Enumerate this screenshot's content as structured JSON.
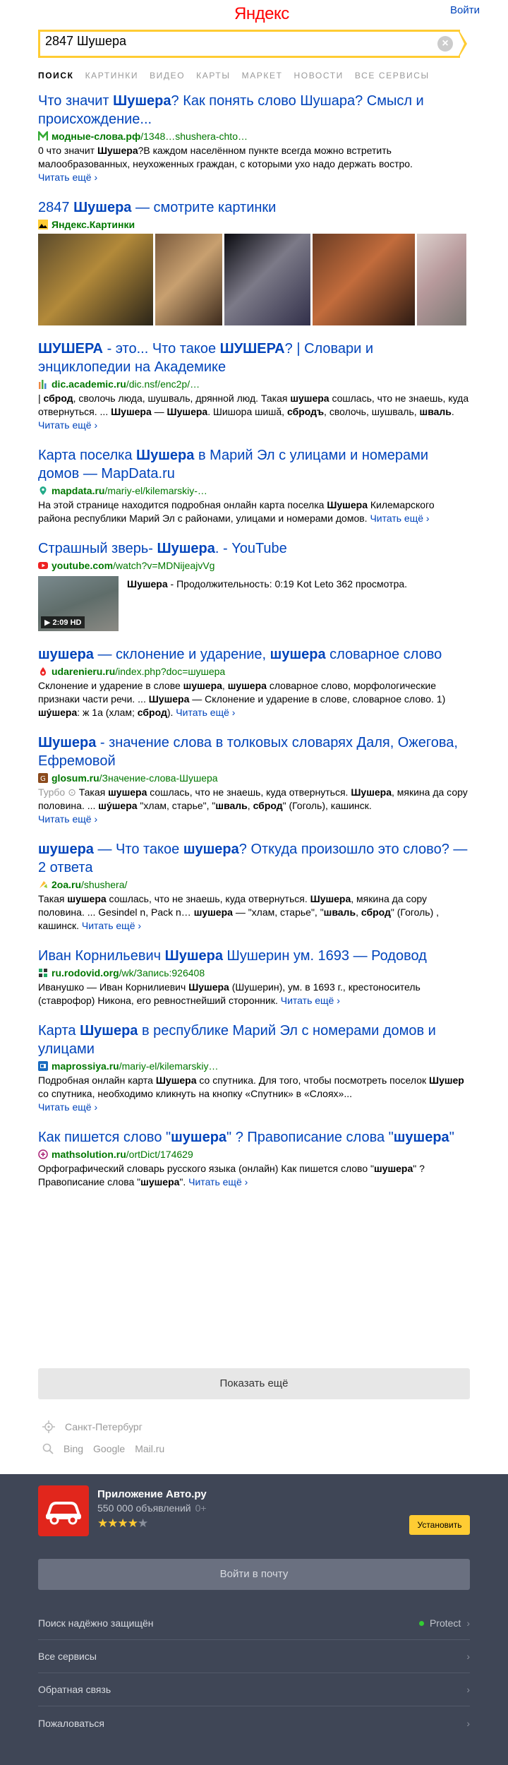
{
  "header": {
    "logo": "Яндекс",
    "login": "Войти"
  },
  "search": {
    "value": "2847 Шушера"
  },
  "tabs": [
    "Поиск",
    "Картинки",
    "Видео",
    "Карты",
    "Маркет",
    "Новости",
    "Все сервисы"
  ],
  "more_label": "Читать ещё ›",
  "results": [
    {
      "title_parts": [
        [
          "t",
          "Что значит "
        ],
        [
          "b",
          "Шушера"
        ],
        [
          "t",
          "? Как понять слово Шушара? Смысл и происхождение..."
        ]
      ],
      "url_host": "модные-слова.рф",
      "url_path": "/1348…shushera-chto…",
      "favicon": "m-icon",
      "text_parts": [
        [
          "t",
          "0 что значит "
        ],
        [
          "b",
          "Шушера"
        ],
        [
          "t",
          "?В каждом населённом пункте всегда можно встретить малообразованных, неухоженных граждан, с которыми ухо надо держать востро."
        ]
      ],
      "more_newline": true
    },
    {
      "title_parts": [
        [
          "t",
          "2847 "
        ],
        [
          "b",
          "Шушера"
        ],
        [
          "t",
          " — смотрите картинки"
        ]
      ],
      "url_host": "Яндекс.Картинки",
      "url_path": "",
      "favicon": "images-icon",
      "images": true
    },
    {
      "title_parts": [
        [
          "b",
          "ШУШЕРА"
        ],
        [
          "t",
          " - это... Что такое "
        ],
        [
          "b",
          "ШУШЕРА"
        ],
        [
          "t",
          "? | Словари и энциклопедии на Академике"
        ]
      ],
      "url_host": "dic.academic.ru",
      "url_path": "/dic.nsf/enc2p/…",
      "favicon": "academic-icon",
      "text_parts": [
        [
          "t",
          "| "
        ],
        [
          "b",
          "сброд"
        ],
        [
          "t",
          ", сволочь люда, шушваль, дрянной люд. Такая "
        ],
        [
          "b",
          "шушера"
        ],
        [
          "t",
          " сошлась, что не знаешь, куда отвернуться. ... "
        ],
        [
          "b",
          "Шушера"
        ],
        [
          "t",
          " — "
        ],
        [
          "b",
          "Шушера"
        ],
        [
          "t",
          ". Шишора шишӑ, "
        ],
        [
          "b",
          "сбродъ"
        ],
        [
          "t",
          ", сволочь, шушваль, "
        ],
        [
          "b",
          "шваль"
        ],
        [
          "t",
          ". "
        ]
      ]
    },
    {
      "title_parts": [
        [
          "t",
          "Карта поселка "
        ],
        [
          "b",
          "Шушера"
        ],
        [
          "t",
          " в Марий Эл с улицами и номерами домов — MapData.ru"
        ]
      ],
      "url_host": "mapdata.ru",
      "url_path": "/mariy-el/kilemarskiy-…",
      "favicon": "map-pin-icon",
      "text_parts": [
        [
          "t",
          "На этой странице находится подробная онлайн карта поселка "
        ],
        [
          "b",
          "Шушера"
        ],
        [
          "t",
          " Килемарского района республики Марий Эл с районами, улицами и номерами домов. "
        ]
      ]
    },
    {
      "title_parts": [
        [
          "t",
          "Страшный зверь- "
        ],
        [
          "b",
          "Шушера"
        ],
        [
          "t",
          ". - YouTube"
        ]
      ],
      "url_host": "youtube.com",
      "url_path": "/watch?v=MDNijeajvVg",
      "favicon": "youtube-icon",
      "video": {
        "duration": "2:09 HD",
        "text_parts": [
          [
            "b",
            "Шушера"
          ],
          [
            "t",
            " - Продолжительность: 0:19 Kot Leto 362 просмотра."
          ]
        ]
      }
    },
    {
      "title_parts": [
        [
          "b",
          "шушера"
        ],
        [
          "t",
          " — склонение и ударение, "
        ],
        [
          "b",
          "шушера"
        ],
        [
          "t",
          " словарное слово"
        ]
      ],
      "url_host": "udarenieru.ru",
      "url_path": "/index.php?doc=шушера",
      "favicon": "udarenie-icon",
      "text_parts": [
        [
          "t",
          "Склонение и ударение в слове "
        ],
        [
          "b",
          "шушера"
        ],
        [
          "t",
          ", "
        ],
        [
          "b",
          "шушера"
        ],
        [
          "t",
          " словарное слово, морфологические признаки части речи. ... "
        ],
        [
          "b",
          "Шушера"
        ],
        [
          "t",
          " — Склонение и ударение в слове, словарное слово. 1) "
        ],
        [
          "b",
          "шу́шера"
        ],
        [
          "t",
          ": ж 1а (хлам; "
        ],
        [
          "b",
          "сброд"
        ],
        [
          "t",
          "). "
        ]
      ]
    },
    {
      "title_parts": [
        [
          "b",
          "Шушера"
        ],
        [
          "t",
          " - значение слова в толковых словарях Даля, Ожегова, Ефремовой"
        ]
      ],
      "url_host": "glosum.ru",
      "url_path": "/Значение-слова-Шушера",
      "favicon": "glosum-icon",
      "turbo": "Турбо",
      "text_parts": [
        [
          "t",
          "Такая "
        ],
        [
          "b",
          "шушера"
        ],
        [
          "t",
          " сошлась, что не знаешь, куда отвернуться. "
        ],
        [
          "b",
          "Шушера"
        ],
        [
          "t",
          ", мякина да сору половина. ... "
        ],
        [
          "b",
          "шу́шера"
        ],
        [
          "t",
          " \"хлам, старье\", \""
        ],
        [
          "b",
          "шваль"
        ],
        [
          "t",
          ", "
        ],
        [
          "b",
          "сброд"
        ],
        [
          "t",
          "\" (Гоголь), кашинск."
        ]
      ],
      "more_newline": true
    },
    {
      "title_parts": [
        [
          "b",
          "шушера"
        ],
        [
          "t",
          " — Что такое "
        ],
        [
          "b",
          "шушера"
        ],
        [
          "t",
          "? Откуда произошло это слово? — 2 ответа"
        ]
      ],
      "url_host": "2oa.ru",
      "url_path": "/shushera/",
      "favicon": "2oa-icon",
      "text_parts": [
        [
          "t",
          "Такая "
        ],
        [
          "b",
          "шушера"
        ],
        [
          "t",
          " сошлась, что не знаешь, куда отвернуться. "
        ],
        [
          "b",
          "Шушера"
        ],
        [
          "t",
          ", мякина да сору половина. ... Gesindel n, Pack n… "
        ],
        [
          "b",
          "шушера"
        ],
        [
          "t",
          " — \"хлам, старье\", \""
        ],
        [
          "b",
          "шваль"
        ],
        [
          "t",
          ", "
        ],
        [
          "b",
          "сброд"
        ],
        [
          "t",
          "\" (Гоголь) , кашинск. "
        ]
      ]
    },
    {
      "title_parts": [
        [
          "t",
          "Иван Корнильевич "
        ],
        [
          "b",
          "Шушера"
        ],
        [
          "t",
          " Шушерин ум. 1693 — Родовод"
        ]
      ],
      "url_host": "ru.rodovid.org",
      "url_path": "/wk/Запись:926408",
      "favicon": "rodovid-icon",
      "text_parts": [
        [
          "t",
          "Иванушко — Иван Корнилиевич "
        ],
        [
          "b",
          "Шушера"
        ],
        [
          "t",
          " (Шушерин), ум. в 1693 г., крестоноситель (ставрофор) Никона, его ревностнейший сторонник. "
        ]
      ]
    },
    {
      "title_parts": [
        [
          "t",
          "Карта "
        ],
        [
          "b",
          "Шушера"
        ],
        [
          "t",
          " в республике Марий Эл с номерами домов и улицами"
        ]
      ],
      "url_host": "maprossiya.ru",
      "url_path": "/mariy-el/kilemarskiy…",
      "favicon": "maprossiya-icon",
      "text_parts": [
        [
          "t",
          "Подробная онлайн карта "
        ],
        [
          "b",
          "Шушера"
        ],
        [
          "t",
          " со спутника. Для того, чтобы посмотреть поселок "
        ],
        [
          "b",
          "Шушер"
        ],
        [
          "t",
          " со спутника, необходимо кликнуть на кнопку «Спутник» в «Слоях»..."
        ]
      ],
      "more_newline": true
    },
    {
      "title_parts": [
        [
          "t",
          "Как пишется слово \""
        ],
        [
          "b",
          "шушера"
        ],
        [
          "t",
          "\" ? Правописание слова \""
        ],
        [
          "b",
          "шушера"
        ],
        [
          "t",
          "\""
        ]
      ],
      "url_host": "mathsolution.ru",
      "url_path": "/ortDict/174629",
      "favicon": "mathsolution-icon",
      "text_parts": [
        [
          "t",
          "Орфографический словарь русского языка (онлайн) Как пишется слово \""
        ],
        [
          "b",
          "шушера"
        ],
        [
          "t",
          "\" ? Правописание слова \""
        ],
        [
          "b",
          "шушера"
        ],
        [
          "t",
          "\". "
        ]
      ]
    }
  ],
  "show_more": "Показать ещё",
  "region": "Санкт-Петербург",
  "engines": [
    "Bing",
    "Google",
    "Mail.ru"
  ],
  "footer": {
    "app_name": "Приложение Авто.ру",
    "app_count": "550 000 объявлений",
    "app_age": "0+",
    "app_rating": 4.5,
    "install": "Установить",
    "mail_login": "Войти в почту",
    "items": [
      {
        "label": "Поиск надёжно защищён",
        "right": "Protect"
      },
      {
        "label": "Все сервисы",
        "right": ""
      },
      {
        "label": "Обратная связь",
        "right": ""
      },
      {
        "label": "Пожаловаться",
        "right": ""
      }
    ],
    "colors": {
      "bg": "#3f4656",
      "accent": "#ffcc33",
      "app_icon": "#e1261c"
    }
  }
}
